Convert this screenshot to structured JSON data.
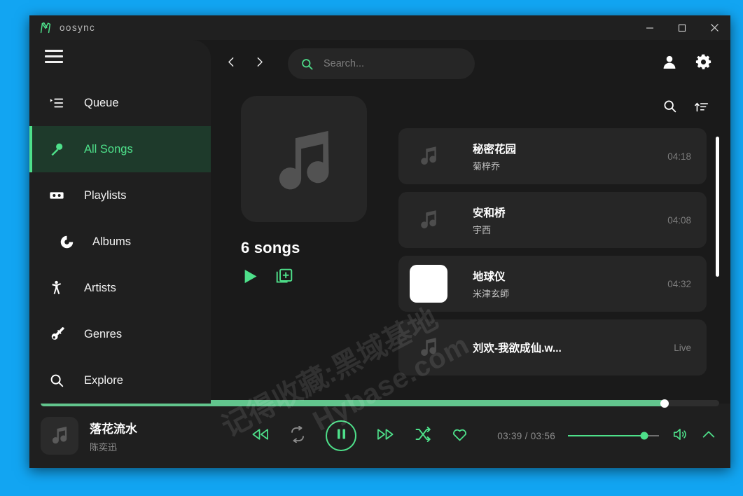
{
  "window": {
    "title": "oosync",
    "logo_icon": "moosync-logo-icon",
    "controls": {
      "minimize": "minimize-icon",
      "maximize": "maximize-icon",
      "close": "close-icon"
    }
  },
  "sidebar": {
    "menu_icon": "hamburger-icon",
    "items": [
      {
        "label": "Queue",
        "icon": "queue-icon",
        "active": false,
        "indent": false
      },
      {
        "label": "All Songs",
        "icon": "microphone-icon",
        "active": true,
        "indent": false
      },
      {
        "label": "Playlists",
        "icon": "cassette-icon",
        "active": false,
        "indent": false
      },
      {
        "label": "Albums",
        "icon": "disc-icon",
        "active": false,
        "indent": true
      },
      {
        "label": "Artists",
        "icon": "person-icon",
        "active": false,
        "indent": false
      },
      {
        "label": "Genres",
        "icon": "guitar-icon",
        "active": false,
        "indent": false
      },
      {
        "label": "Explore",
        "icon": "search-icon",
        "active": false,
        "indent": false
      }
    ]
  },
  "topbar": {
    "back_icon": "chevron-left-icon",
    "forward_icon": "chevron-right-icon",
    "search": {
      "icon": "search-icon",
      "value": "",
      "placeholder": "Search..."
    },
    "account_icon": "person-icon",
    "settings_icon": "gear-icon"
  },
  "hero": {
    "artwork_icon": "music-note-icon",
    "count_label": "6 songs",
    "play_icon": "play-icon",
    "add_to_queue_icon": "add-to-queue-icon"
  },
  "list": {
    "search_icon": "search-icon",
    "sort_icon": "sort-ascending-icon",
    "songs": [
      {
        "title": "秘密花园",
        "artist": "菊梓乔",
        "duration": "04:18",
        "art": "music-note-icon",
        "art_style": "default"
      },
      {
        "title": "安和桥",
        "artist": "宇西",
        "duration": "04:08",
        "art": "music-note-icon",
        "art_style": "default"
      },
      {
        "title": "地球仪",
        "artist": "米津玄師",
        "duration": "04:32",
        "art": "album-cover",
        "art_style": "white"
      },
      {
        "title": "刘欢-我欲成仙.w...",
        "artist": "",
        "duration": "Live",
        "art": "music-note-icon",
        "art_style": "default"
      }
    ]
  },
  "player": {
    "progress_percent": 92,
    "now_playing": {
      "artwork_icon": "music-note-icon",
      "title": "落花流水",
      "artist": "陈奕迅"
    },
    "controls": [
      {
        "name": "rewind-button",
        "icon": "rewind-icon",
        "state": "active"
      },
      {
        "name": "repeat-button",
        "icon": "repeat-icon",
        "state": "muted"
      },
      {
        "name": "play-pause-button",
        "icon": "pause-icon",
        "state": "active"
      },
      {
        "name": "fast-forward-button",
        "icon": "fast-forward-icon",
        "state": "active"
      },
      {
        "name": "shuffle-button",
        "icon": "shuffle-icon",
        "state": "active"
      },
      {
        "name": "favorite-button",
        "icon": "heart-icon",
        "state": "active"
      }
    ],
    "time_elapsed": "03:39",
    "time_total": "03:56",
    "time_display": "03:39 / 03:56",
    "volume_percent": 84,
    "volume_icon": "speaker-icon",
    "expand_icon": "chevron-up-icon"
  },
  "watermark": {
    "line1": "记得收藏:黑域基地",
    "line2": "Hybase.com"
  },
  "colors": {
    "accent_green": "#4ee08a",
    "progress_green": "#62c58d",
    "desktop_blue": "#12a5f2",
    "window_bg": "#1a1a1a",
    "sidebar_bg": "#1f1f1f",
    "row_bg": "#262626"
  }
}
